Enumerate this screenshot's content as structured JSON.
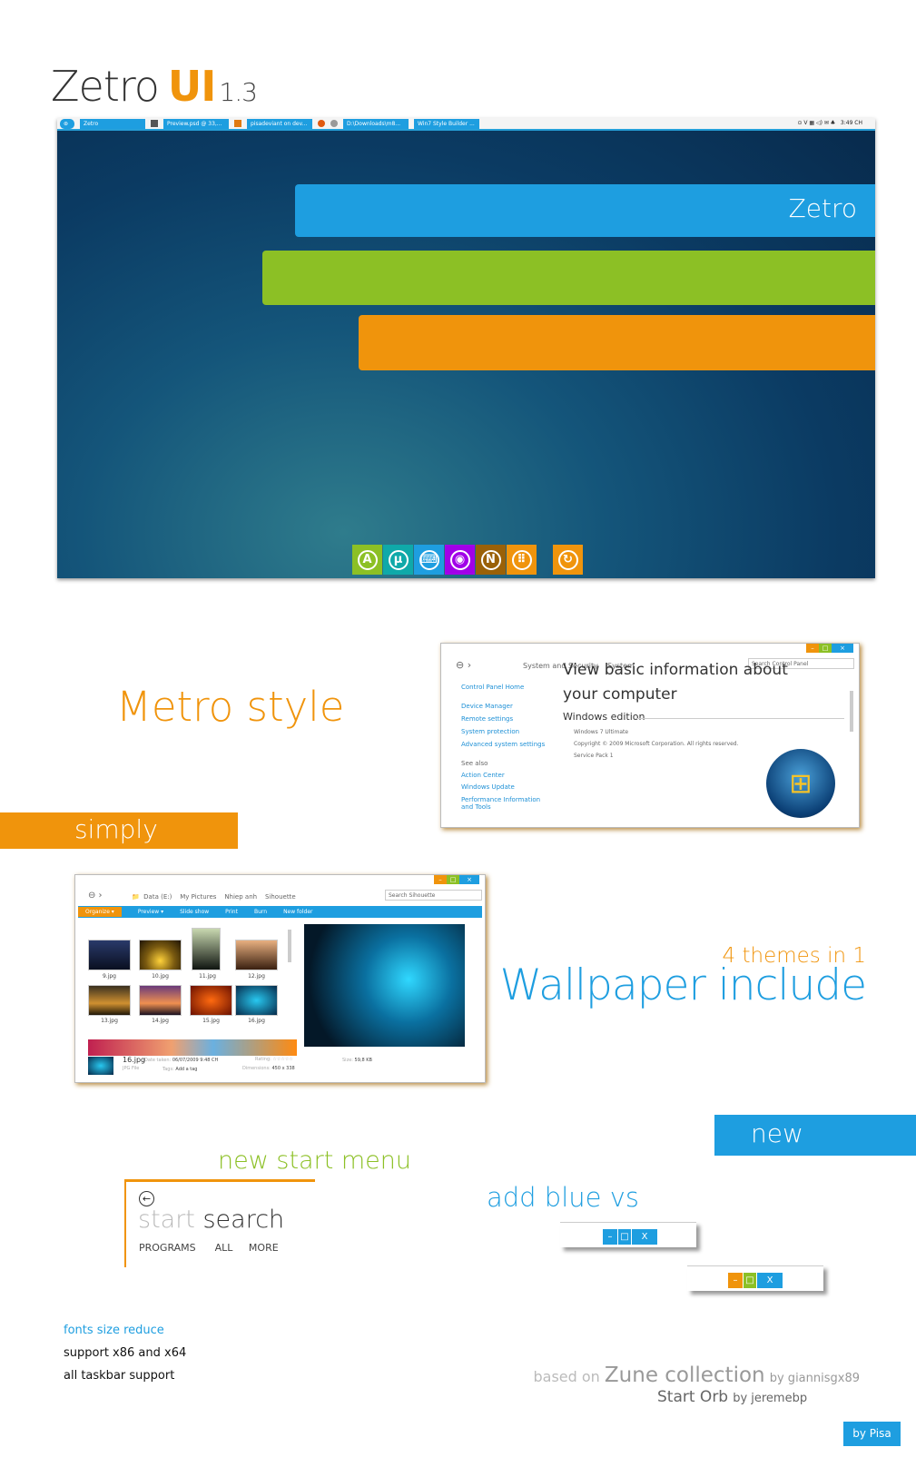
{
  "header": {
    "name": "Zetro",
    "ui": "UI",
    "version": "1.3"
  },
  "desktop": {
    "taskbar": {
      "items": [
        "Zetro",
        "Preview.psd @ 33,...",
        "pisadeviant on dev...",
        "D:\\Downloads\\m8...",
        "Win7 Style Builder ..."
      ],
      "clock": "3:49 CH",
      "tray": "⊙ V ▦ ◁) ✉ ♣"
    },
    "stripe_label": "Zetro",
    "stripe_colors": [
      "#1e9ee0",
      "#8cc025",
      "#f0940c"
    ],
    "dock": [
      {
        "icon": "A",
        "color": "#8cc025"
      },
      {
        "icon": "µ",
        "color": "#0fa9a9"
      },
      {
        "icon": "⌨",
        "color": "#1e9ee0"
      },
      {
        "icon": "◉",
        "color": "#a100e8"
      },
      {
        "icon": "N",
        "color": "#9a6108"
      },
      {
        "icon": "⠿",
        "color": "#f0940c"
      },
      {
        "icon": "↻",
        "color": "#f0940c"
      }
    ]
  },
  "metro": {
    "heading": "Metro style",
    "banner": "simply"
  },
  "control_panel": {
    "breadcrumb": [
      "System and Security",
      "System"
    ],
    "search_placeholder": "Search Control Panel",
    "home": "Control Panel Home",
    "tasks": [
      "Device Manager",
      "Remote settings",
      "System protection",
      "Advanced system settings"
    ],
    "see_also": "See also",
    "see_links": [
      "Action Center",
      "Windows Update",
      "Performance Information and Tools"
    ],
    "heading": "View basic information about your computer",
    "section": "Windows edition",
    "lines": [
      "Windows 7 Ultimate",
      "Copyright © 2009 Microsoft Corporation.  All rights reserved.",
      "Service Pack 1"
    ]
  },
  "explorer": {
    "breadcrumb": [
      "Data (E:)",
      "My Pictures",
      "Nhiep anh",
      "Sihouette"
    ],
    "search_placeholder": "Search Sihouette",
    "toolbar": [
      "Organize ▾",
      "Preview ▾",
      "Slide show",
      "Print",
      "Burn",
      "New folder"
    ],
    "files": [
      "9.jpg",
      "10.jpg",
      "11.jpg",
      "12.jpg",
      "13.jpg",
      "14.jpg",
      "15.jpg",
      "16.jpg"
    ],
    "details": {
      "name": "16.jpg",
      "type": "JPG File",
      "date_label": "Date taken:",
      "date": "06/07/2009 9:48 CH",
      "tags_label": "Tags:",
      "tags": "Add a tag",
      "rating_label": "Rating:",
      "rating": "☆☆☆☆☆",
      "dim_label": "Dimensions:",
      "dim": "450 x 338",
      "size_label": "Size:",
      "size": "59,8 KB"
    }
  },
  "wallpaper": {
    "sub": "4 themes in 1",
    "heading": "Wallpaper include"
  },
  "new_badge": "new",
  "start_menu": {
    "heading": "new start menu",
    "start": "start",
    "search": "search",
    "tabs": [
      "PROGRAMS",
      "ALL",
      "MORE"
    ]
  },
  "blue_vs": {
    "heading": "add blue vs",
    "buttons": [
      "–",
      "□",
      "X"
    ]
  },
  "features": [
    "fonts size reduce",
    "support x86 and x64",
    "all taskbar support"
  ],
  "credits": {
    "based_on": "based on",
    "zune": "Zune collection",
    "by1": "by giannisgx89",
    "orb": "Start Orb",
    "by2": "by jeremebp"
  },
  "author": "by Pisa"
}
